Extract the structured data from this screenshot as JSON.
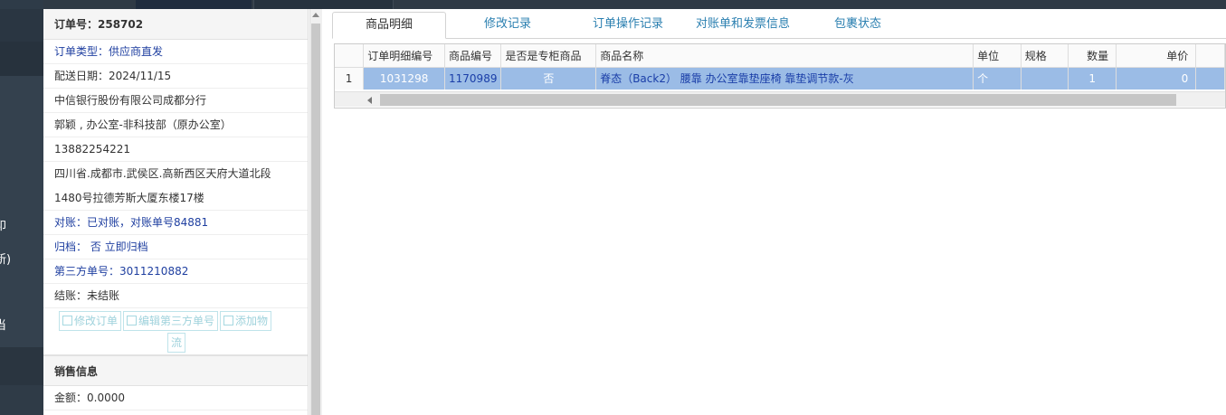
{
  "nav": {
    "labels": [
      "卬",
      "新)",
      "当"
    ]
  },
  "order": {
    "title": "订单号：258702",
    "type": "订单类型：供应商直发",
    "delivery_date": "配送日期：2024/11/15",
    "company": "中信银行股份有限公司成都分行",
    "contact": "郭颖 , 办公室-非科技部（原办公室）",
    "phone": "13882254221",
    "address_line1": "四川省.成都市.武侯区.高新西区天府大道北段",
    "address_line2": "1480号拉德芳斯大厦东楼17楼",
    "reconcile": "对账：已对账，对账单号84881",
    "archive": "归档： 否 立即归档",
    "third_party": "第三方单号：3011210882",
    "settle": "结账：未结账"
  },
  "buttons": {
    "edit_order": "修改订单",
    "edit_third": "编辑第三方单号",
    "add_logistics_1": "添加物",
    "add_logistics_2": "流"
  },
  "sales": {
    "title": "销售信息",
    "amount": "金额：0.0000"
  },
  "tabs": [
    "商品明细",
    "修改记录",
    "订单操作记录",
    "对账单和发票信息",
    "包裹状态"
  ],
  "grid": {
    "headers": [
      "订单明细编号",
      "商品编号",
      "是否是专柜商品",
      "商品名称",
      "单位",
      "规格",
      "数量",
      "单价"
    ],
    "rows": [
      {
        "rownum": "1",
        "detail_id": "1031298",
        "product_id": "1170989",
        "is_counter": "否",
        "name": "脊态（Back2） 腰靠 办公室靠垫座椅 靠垫调节款-灰",
        "unit": "个",
        "spec": "",
        "qty": "1",
        "price": "0"
      }
    ]
  }
}
